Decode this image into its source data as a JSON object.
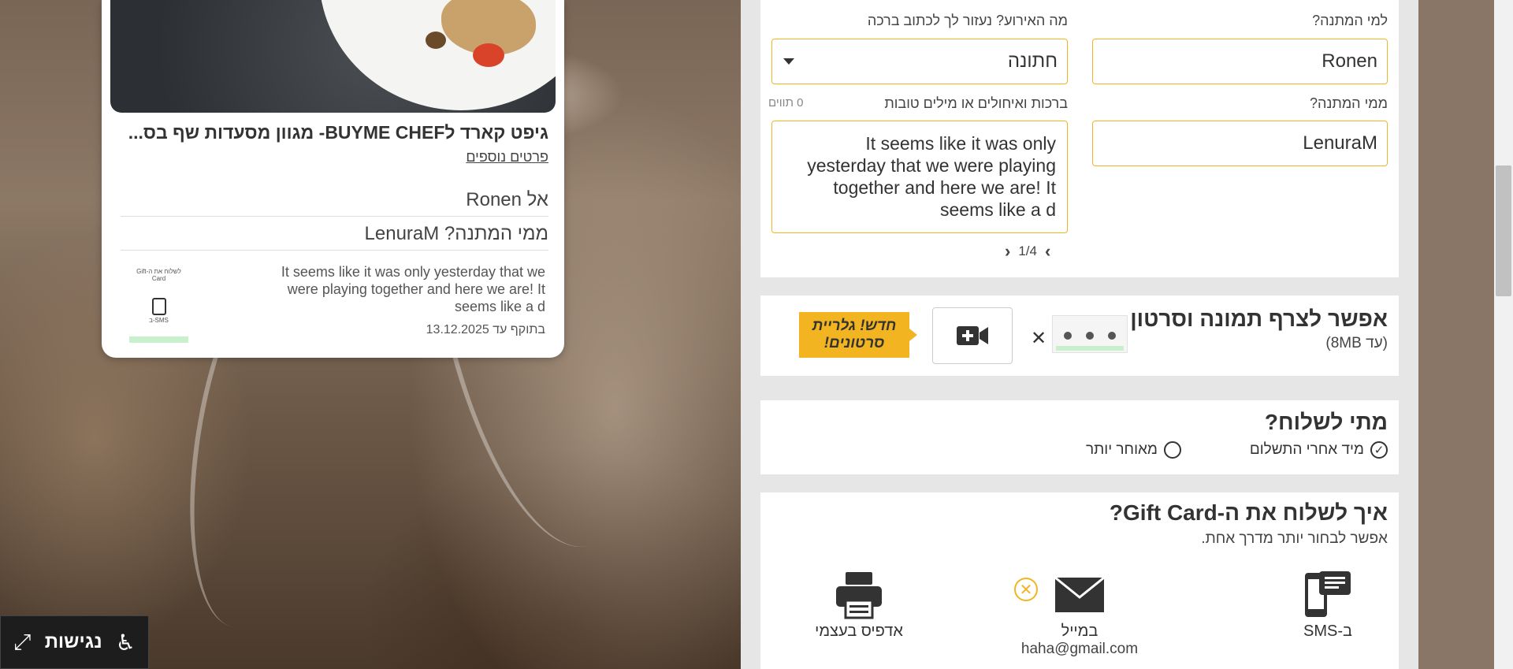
{
  "preview_card": {
    "title": "גיפט קארד לBUYME CHEF- מגוון מסעדות שף בס...",
    "more_details": "פרטים נוספים",
    "to_row": "אל  Ronen",
    "from_row": "ממי המתנה?  LenuraM",
    "message": "It seems like it was only yesterday that we were playing together and here we are! It seems like a d",
    "valid_until": "בתוקף עד 13.12.2025",
    "thumb_text": "לשלוח את ה-Gift Card",
    "thumb_sms": "SMS-ב"
  },
  "accessibility": {
    "label": "נגישות"
  },
  "form": {
    "recipient_label": "למי המתנה?",
    "recipient_value": "Ronen",
    "event_label": "מה האירוע? נעזור לך לכתוב ברכה",
    "event_value": "חתונה",
    "sender_label": "ממי המתנה?",
    "sender_value": "LenuraM",
    "greeting_label": "ברכות ואיחולים או מילים טובות",
    "char_count": "0 תווים",
    "greeting_value": "It seems like it was only yesterday that we were playing together and here we are! It seems like a d",
    "pager": "1/4"
  },
  "media": {
    "title": "אפשר לצרף תמונה וסרטון",
    "subtitle": "(עד 8MB)",
    "new_badge": "חדש! גלריית סרטונים!"
  },
  "when": {
    "title": "מתי לשלוח?",
    "option_now": "מיד אחרי התשלום",
    "option_later": "מאוחר יותר"
  },
  "how": {
    "title": "איך לשלוח את ה-Gift Card?",
    "subtitle": "אפשר לבחור יותר מדרך אחת.",
    "sms_label": "ב-SMS",
    "email_label": "במייל",
    "email_value": "haha@gmail.com",
    "print_label": "אדפיס בעצמי"
  },
  "colors": {
    "accent": "#f2b521",
    "panel_bg": "#e6e6e6"
  }
}
